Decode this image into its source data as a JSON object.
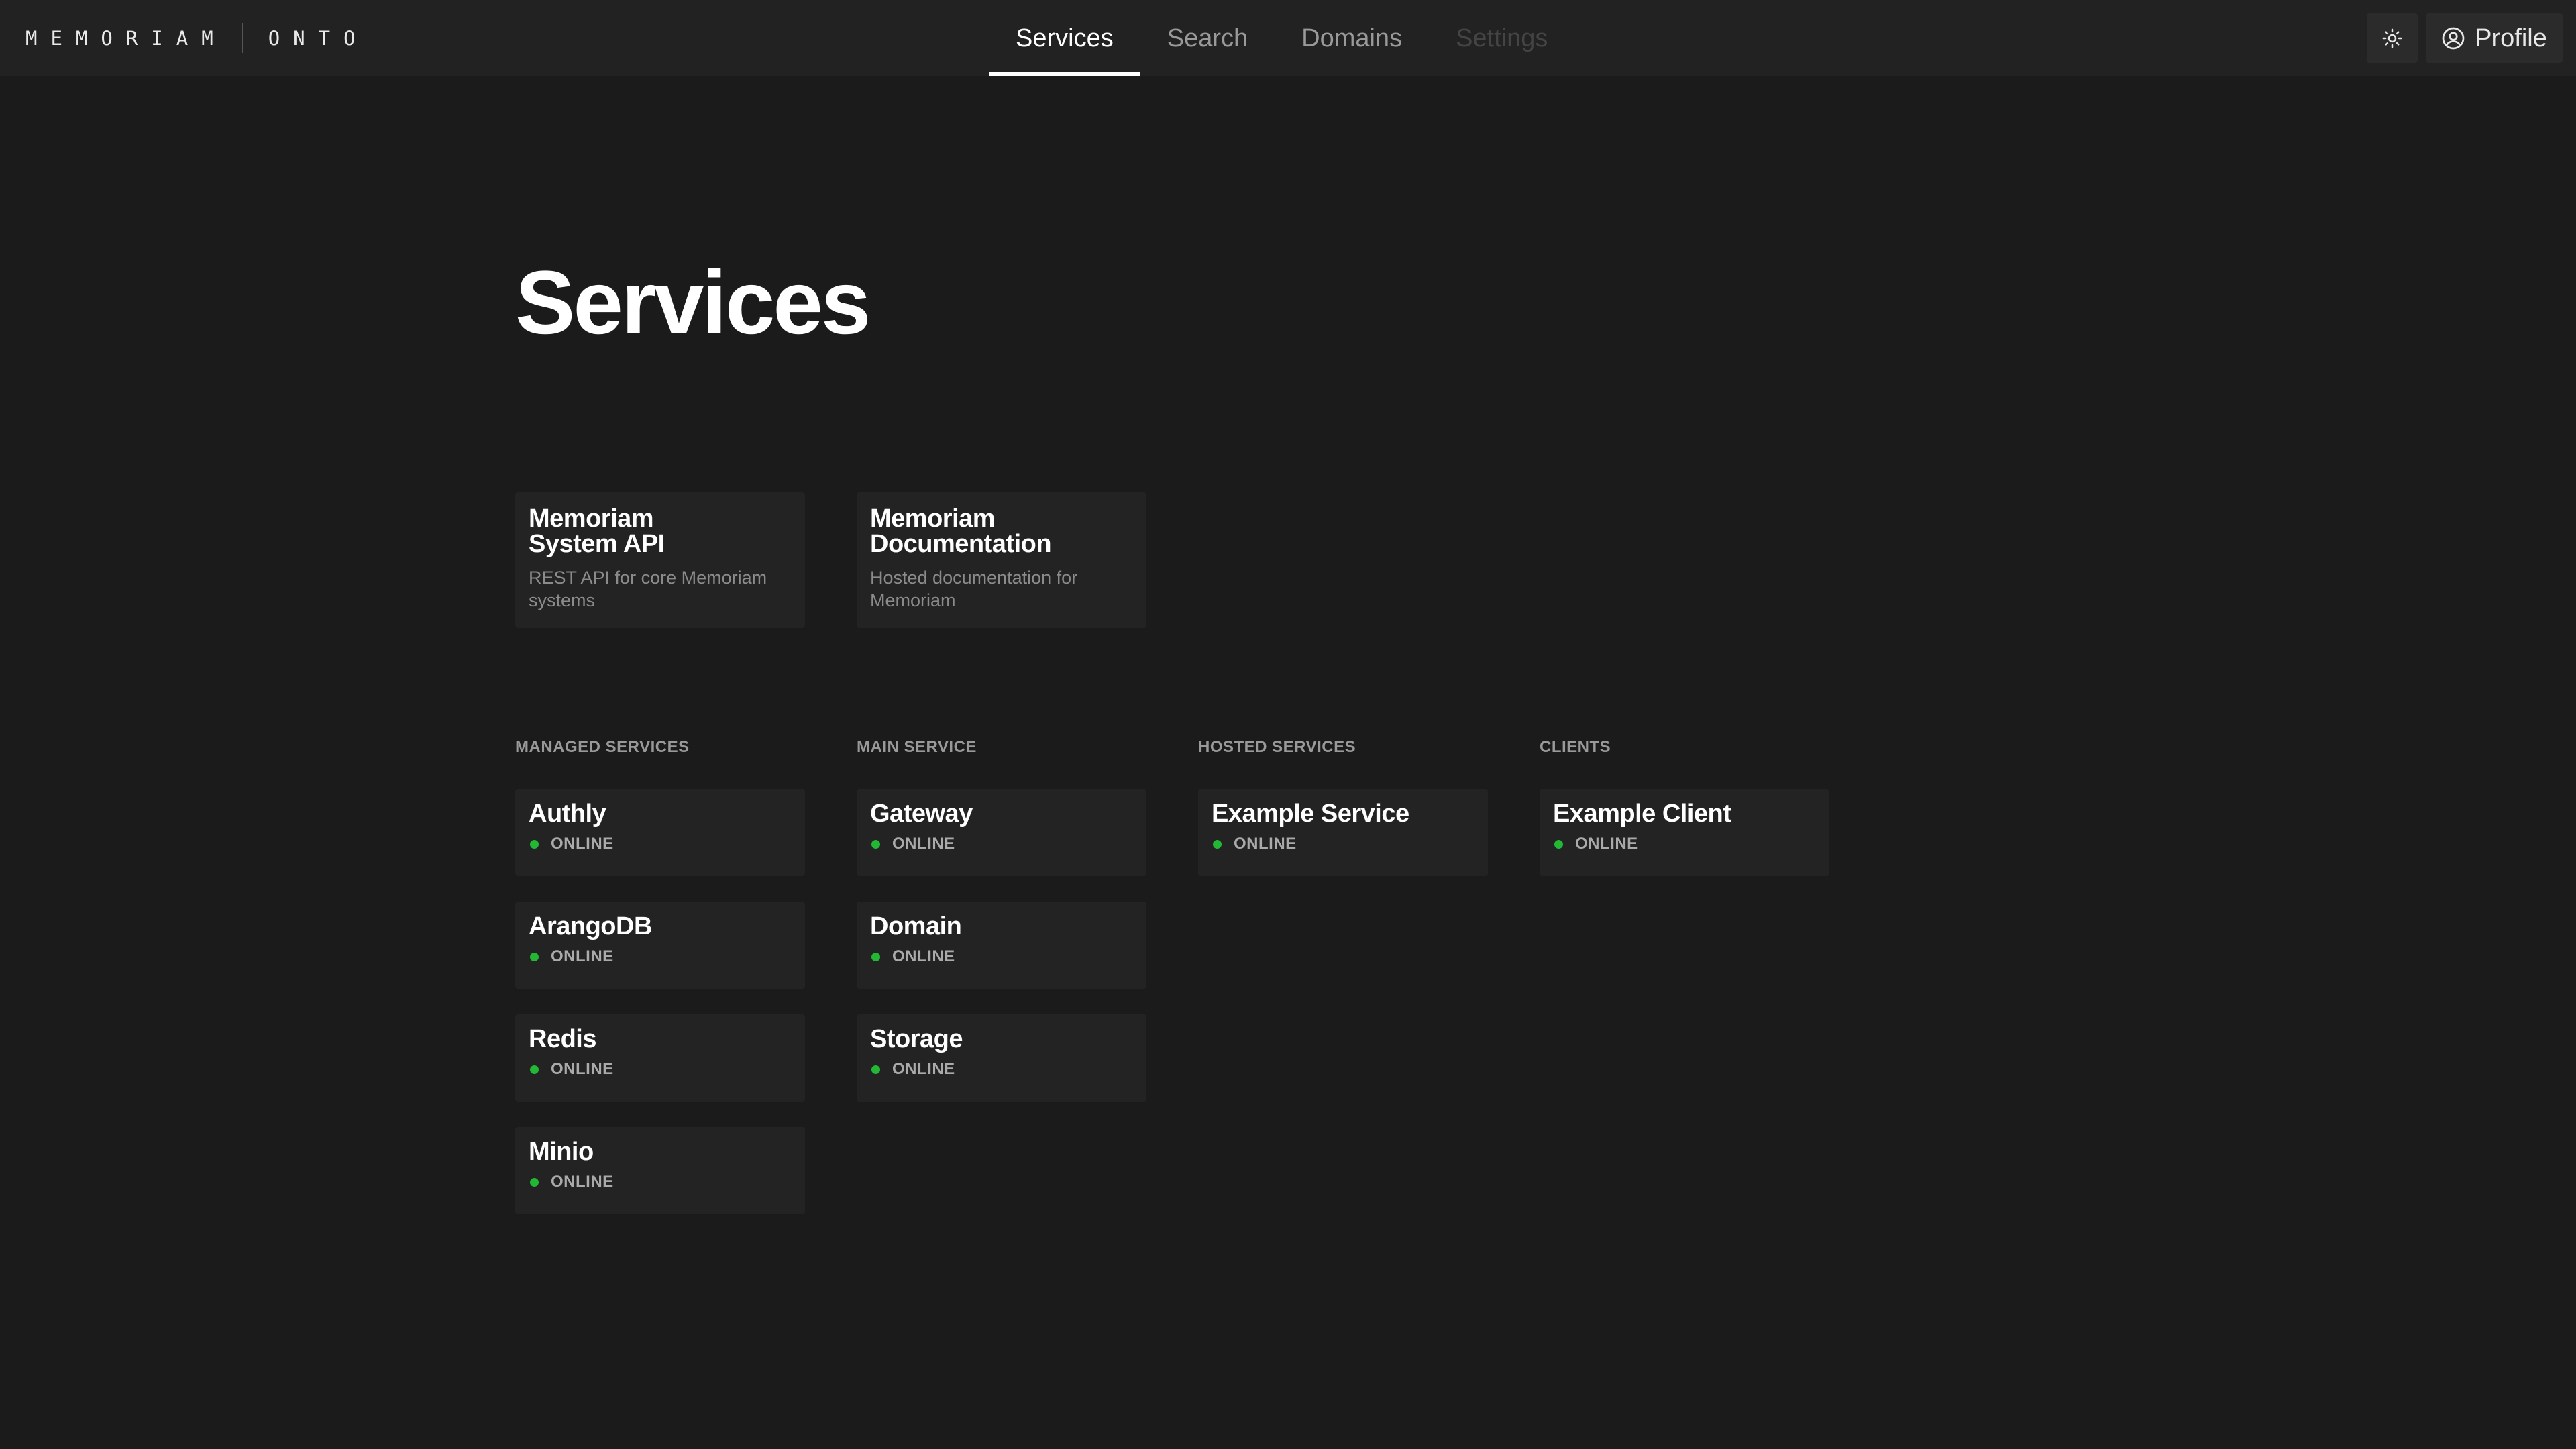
{
  "brand": {
    "name": "MEMORIAM",
    "product": "ONTO"
  },
  "nav": {
    "tabs": [
      {
        "label": "Services",
        "state": "active"
      },
      {
        "label": "Search",
        "state": "normal"
      },
      {
        "label": "Domains",
        "state": "normal"
      },
      {
        "label": "Settings",
        "state": "disabled"
      }
    ]
  },
  "header": {
    "theme_icon": "sun-icon",
    "profile_icon": "user-circle-icon",
    "profile_label": "Profile"
  },
  "page": {
    "title": "Services"
  },
  "featured": [
    {
      "title_line1": "Memoriam",
      "title_line2": "System API",
      "description": "REST API for core Memoriam systems"
    },
    {
      "title_line1": "Memoriam",
      "title_line2": "Documentation",
      "description": "Hosted documentation for Memoriam"
    }
  ],
  "sections": {
    "managed": {
      "label": "MANAGED SERVICES",
      "items": [
        {
          "name": "Authly",
          "status": "ONLINE"
        },
        {
          "name": "ArangoDB",
          "status": "ONLINE"
        },
        {
          "name": "Redis",
          "status": "ONLINE"
        },
        {
          "name": "Minio",
          "status": "ONLINE"
        }
      ]
    },
    "main": {
      "label": "MAIN SERVICE",
      "items": [
        {
          "name": "Gateway",
          "status": "ONLINE"
        },
        {
          "name": "Domain",
          "status": "ONLINE"
        },
        {
          "name": "Storage",
          "status": "ONLINE"
        }
      ]
    },
    "hosted": {
      "label": "HOSTED SERVICES",
      "items": [
        {
          "name": "Example Service",
          "status": "ONLINE"
        }
      ]
    },
    "clients": {
      "label": "CLIENTS",
      "items": [
        {
          "name": "Example Client",
          "status": "ONLINE"
        }
      ]
    }
  },
  "colors": {
    "background": "#1b1b1b",
    "topbar": "#222222",
    "card": "#232323",
    "status_online": "#22b833"
  }
}
